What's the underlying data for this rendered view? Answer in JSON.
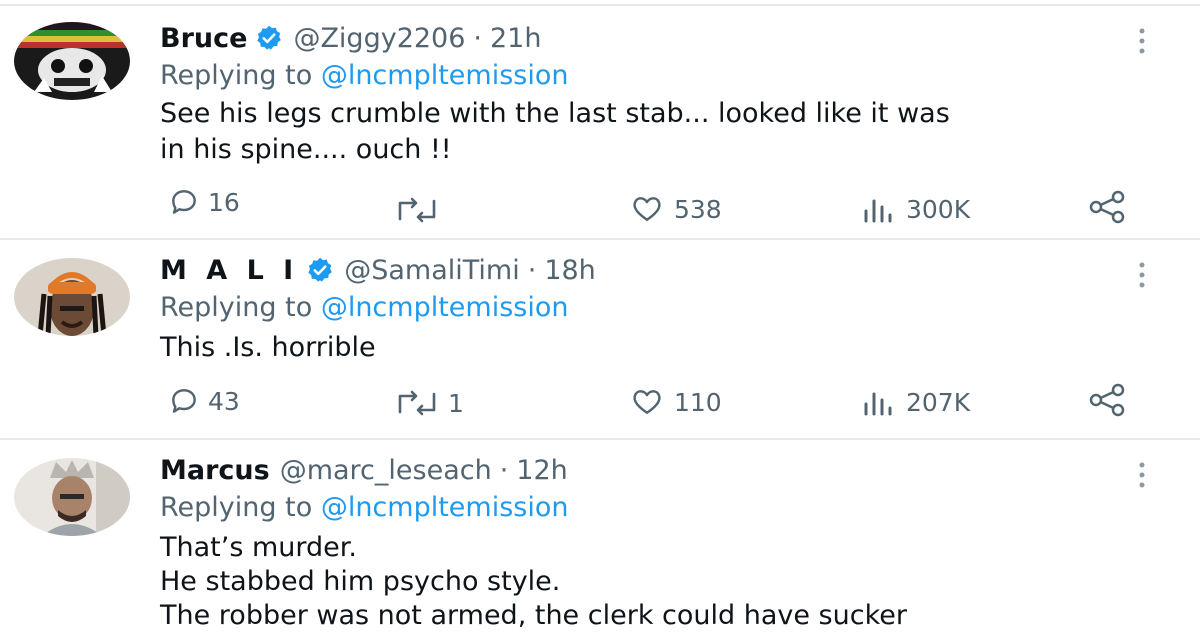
{
  "tweets": [
    {
      "name": "Bruce",
      "verified": true,
      "handle": "@Ziggy2206",
      "separator": "·",
      "time": "21h",
      "replying_prefix": "Replying to",
      "replying_handle": "@lncmpltemission",
      "text_lines": [
        "See his legs crumble with the last stab... looked like it was",
        "in his spine.... ouch !!"
      ],
      "replies": "16",
      "retweets": "",
      "likes": "538",
      "views": "300K"
    },
    {
      "name": "M A L I",
      "verified": true,
      "handle": "@SamaliTimi",
      "separator": "·",
      "time": "18h",
      "replying_prefix": "Replying to",
      "replying_handle": "@lncmpltemission",
      "text_lines": [
        "This .Is. horrible"
      ],
      "replies": "43",
      "retweets": "1",
      "likes": "110",
      "views": "207K"
    },
    {
      "name": "Marcus",
      "verified": false,
      "handle": "@marc_leseach",
      "separator": "·",
      "time": "12h",
      "replying_prefix": "Replying to",
      "replying_handle": "@lncmpltemission",
      "text_lines": [
        "That’s murder.",
        "He stabbed him psycho style.",
        "The robber was not armed, the clerk could have sucker"
      ]
    }
  ],
  "colors": {
    "accent": "#1d9bf0",
    "secondary_text": "#536471",
    "primary_text": "#0f1419",
    "divider": "#e6e9ec"
  },
  "icons": {
    "reply": "reply-icon",
    "retweet": "retweet-icon",
    "like": "heart-icon",
    "views": "views-icon",
    "share": "share-icon",
    "more": "more-options-icon",
    "verified": "verified-badge-icon"
  }
}
